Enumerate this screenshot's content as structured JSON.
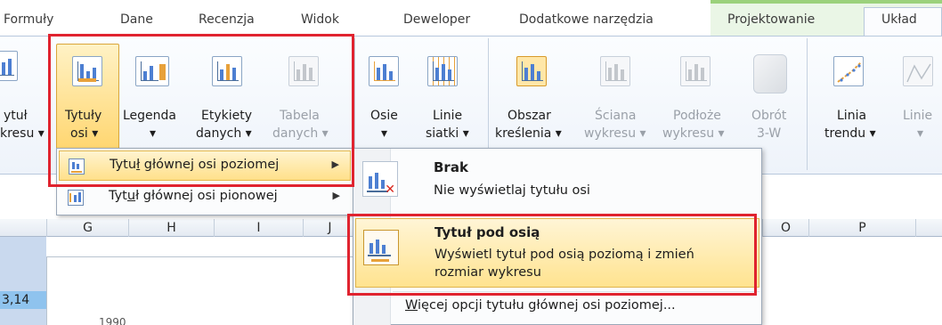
{
  "tabs": [
    {
      "label": "Formuły"
    },
    {
      "label": "Dane"
    },
    {
      "label": "Recenzja"
    },
    {
      "label": "Widok"
    },
    {
      "label": "Deweloper"
    },
    {
      "label": "Dodatkowe narzędzia"
    },
    {
      "label": "Projektowanie"
    },
    {
      "label": "Układ"
    }
  ],
  "ribbon": {
    "partial_left": {
      "line1": "ytuł",
      "line2": "kresu ▾"
    },
    "tytuly_osi": {
      "line1": "Tytuły",
      "line2": "osi ▾"
    },
    "legenda": {
      "line1": "Legenda",
      "line2": "▾"
    },
    "etykiety": {
      "line1": "Etykiety",
      "line2": "danych ▾"
    },
    "tabela": {
      "line1": "Tabela",
      "line2": "danych ▾"
    },
    "osie": {
      "line1": "Osie",
      "line2": "▾"
    },
    "linie_siatki": {
      "line1": "Linie",
      "line2": "siatki ▾"
    },
    "obszar": {
      "line1": "Obszar",
      "line2": "kreślenia ▾"
    },
    "sciana": {
      "line1": "Ściana",
      "line2": "wykresu ▾"
    },
    "podloze": {
      "line1": "Podłoże",
      "line2": "wykresu ▾"
    },
    "obrot": {
      "line1": "Obrót",
      "line2": "3-W"
    },
    "linia_trendu": {
      "line1": "Linia",
      "line2": "trendu ▾"
    },
    "linie_partial": {
      "line1": "Linie",
      "line2": "▾"
    }
  },
  "sheet": {
    "columns": [
      "G",
      "H",
      "I",
      "J",
      "O",
      "P"
    ],
    "cell_value": "3,14",
    "fragment": "1990"
  },
  "menu_axes": {
    "items": [
      {
        "pre": "Tytu",
        "u": "ł",
        "post": " głównej osi poziomej"
      },
      {
        "pre": "Tyt",
        "u": "u",
        "post": "ł głównej osi pionowej"
      }
    ]
  },
  "menu_horizontal": {
    "brak_title": "Brak",
    "brak_desc": "Nie wyświetlaj tytułu osi",
    "pod_title": "Tytuł pod osią",
    "pod_desc1": "Wyświetl tytuł pod osią poziomą i zmień",
    "pod_desc2": "rozmiar wykresu",
    "more_u": "W",
    "more_rest": "ięcej opcji tytułu głównej osi poziomej..."
  },
  "colors": {
    "highlight_border": "#e0232f",
    "hover": "#ffe08a",
    "context_tab": "#9bd17c"
  }
}
